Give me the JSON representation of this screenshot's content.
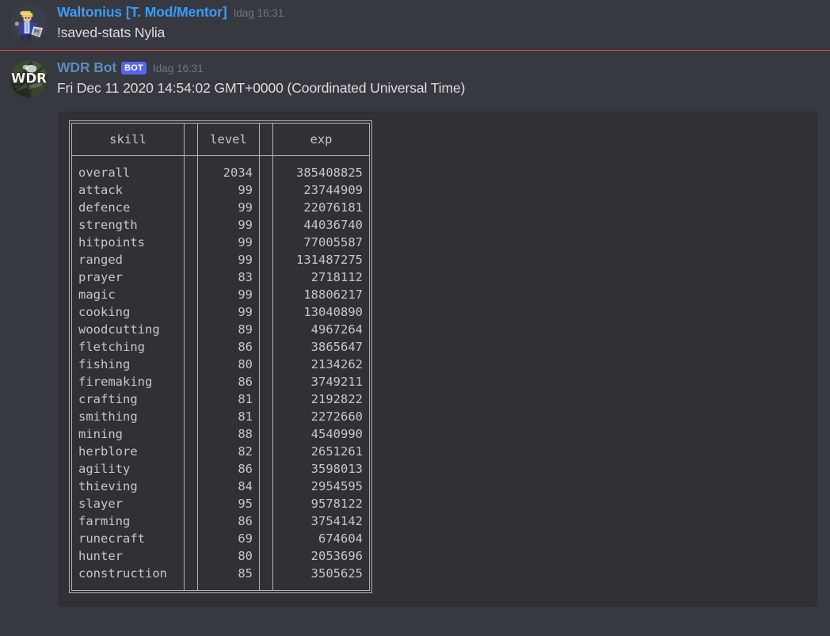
{
  "app": {
    "name": "discord-chat",
    "background": "#36393f"
  },
  "colors": {
    "page_bg": "#36393f",
    "codeblock_bg": "#2f3136",
    "user_name": "#3b9bfc",
    "bot_name": "#5b8cbe",
    "bot_badge": "#5865f2",
    "divider_red": "#f04747",
    "body_text": "#dcddde",
    "mono_text": "#c3c7cb",
    "timestamp": "#72767d",
    "table_border": "#b5b5ad"
  },
  "messages": [
    {
      "id": "user-message",
      "avatar_name": "avatar-waltonius",
      "username": "Waltonius [T. Mod/Mentor]",
      "is_bot": false,
      "timestamp": "Idag 16:31",
      "text": "!saved-stats Nylia"
    },
    {
      "id": "bot-message",
      "avatar_name": "avatar-wdr-bot",
      "username": "WDR Bot",
      "is_bot": true,
      "badge_label": "BOT",
      "timestamp": "Idag 16:31",
      "text": "Fri Dec 11 2020 14:54:02 GMT+0000 (Coordinated Universal Time)"
    }
  ],
  "divider": {
    "label": "new-messages-divider"
  },
  "stats_table": {
    "headers": [
      "skill",
      "level",
      "exp"
    ],
    "rows": [
      {
        "skill": "overall",
        "level": "2034",
        "exp": "385408825"
      },
      {
        "skill": "attack",
        "level": "99",
        "exp": "23744909"
      },
      {
        "skill": "defence",
        "level": "99",
        "exp": "22076181"
      },
      {
        "skill": "strength",
        "level": "99",
        "exp": "44036740"
      },
      {
        "skill": "hitpoints",
        "level": "99",
        "exp": "77005587"
      },
      {
        "skill": "ranged",
        "level": "99",
        "exp": "131487275"
      },
      {
        "skill": "prayer",
        "level": "83",
        "exp": "2718112"
      },
      {
        "skill": "magic",
        "level": "99",
        "exp": "18806217"
      },
      {
        "skill": "cooking",
        "level": "99",
        "exp": "13040890"
      },
      {
        "skill": "woodcutting",
        "level": "89",
        "exp": "4967264"
      },
      {
        "skill": "fletching",
        "level": "86",
        "exp": "3865647"
      },
      {
        "skill": "fishing",
        "level": "80",
        "exp": "2134262"
      },
      {
        "skill": "firemaking",
        "level": "86",
        "exp": "3749211"
      },
      {
        "skill": "crafting",
        "level": "81",
        "exp": "2192822"
      },
      {
        "skill": "smithing",
        "level": "81",
        "exp": "2272660"
      },
      {
        "skill": "mining",
        "level": "88",
        "exp": "4540990"
      },
      {
        "skill": "herblore",
        "level": "82",
        "exp": "2651261"
      },
      {
        "skill": "agility",
        "level": "86",
        "exp": "3598013"
      },
      {
        "skill": "thieving",
        "level": "84",
        "exp": "2954595"
      },
      {
        "skill": "slayer",
        "level": "95",
        "exp": "9578122"
      },
      {
        "skill": "farming",
        "level": "86",
        "exp": "3754142"
      },
      {
        "skill": "runecraft",
        "level": "69",
        "exp": "674604"
      },
      {
        "skill": "hunter",
        "level": "80",
        "exp": "2053696"
      },
      {
        "skill": "construction",
        "level": "85",
        "exp": "3505625"
      }
    ]
  },
  "avatars": {
    "waltonius": {
      "description_name": "pixel-character-avatar",
      "hair": "#e8c45c",
      "jacket": "#3b3fa0",
      "skin": "#f0c9a0",
      "bg": "#3b3d48"
    },
    "wdr_bot": {
      "description_name": "wdr-logo-avatar",
      "text": "WDR",
      "bg": "#2a3326"
    }
  }
}
